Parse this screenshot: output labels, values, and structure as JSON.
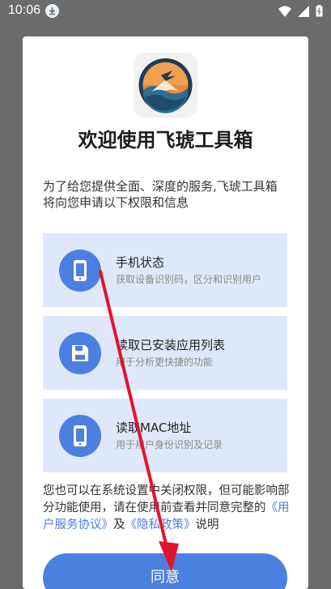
{
  "status_bar": {
    "time": "10:06",
    "icons": [
      "download-icon",
      "wifi-icon",
      "signal-icon",
      "battery-icon"
    ]
  },
  "dialog": {
    "title": "欢迎使用飞琥工具箱",
    "intro": "为了给您提供全面、深度的服务,飞琥工具箱将向您申请以下权限和信息",
    "permissions": [
      {
        "title": "手机状态",
        "desc": "获取设备识别码，区分和识别用户",
        "icon": "phone-icon"
      },
      {
        "title": "读取已安装应用列表",
        "desc": "用于分析更快捷的功能",
        "icon": "save-icon"
      },
      {
        "title": "读取MAC地址",
        "desc": "用于用户身份识别及记录",
        "icon": "phone-icon"
      }
    ],
    "footer_prefix": "您也可以在系统设置中关闭权限，但可能影响部分功能使用，请在使用前查看并同意完整的",
    "user_agreement_link": "《用户服务协议》",
    "and_text": "及",
    "privacy_link": "《隐私政策》",
    "footer_suffix": "说明",
    "agree_button": "同意"
  },
  "colors": {
    "accent": "#4b7fe0",
    "perm_bg": "#dfe8fb",
    "arrow": "#e3132d",
    "scrim": "#6b6b6b"
  }
}
